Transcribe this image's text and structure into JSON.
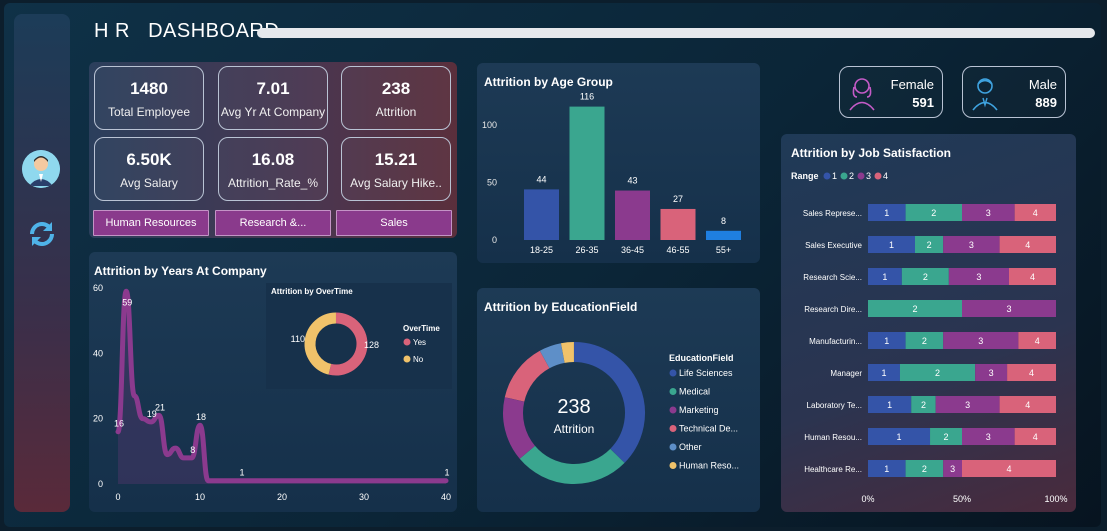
{
  "header": {
    "title": "H R   DASHBOARD"
  },
  "kpis": [
    {
      "value": "1480",
      "label": "Total Employee"
    },
    {
      "value": "7.01",
      "label": "Avg Yr At Company"
    },
    {
      "value": "238",
      "label": "Attrition"
    },
    {
      "value": "6.50K",
      "label": "Avg Salary"
    },
    {
      "value": "16.08",
      "label": "Attrition_Rate_%"
    },
    {
      "value": "15.21",
      "label": "Avg Salary Hike.."
    }
  ],
  "departments": [
    "Human Resources",
    "Research &...",
    "Sales"
  ],
  "gender": {
    "female": {
      "label": "Female",
      "value": "591"
    },
    "male": {
      "label": "Male",
      "value": "889"
    }
  },
  "age_chart": {
    "title": "Attrition by Age Group",
    "yticks": [
      "100",
      "50",
      "0"
    ],
    "colors": [
      "#3454a8",
      "#3aa68f",
      "#8b3a8e",
      "#d9637a",
      "#1f7fe0"
    ]
  },
  "edu_chart": {
    "title": "Attrition by EducationField",
    "center_value": "238",
    "center_label": "Attrition",
    "legend_title": "EducationField",
    "colors": [
      "#3454a8",
      "#3aa68f",
      "#8b3a8e",
      "#d9637a",
      "#5e8fc8",
      "#f0c26a"
    ]
  },
  "years_chart": {
    "title": "Attrition by Years At Company",
    "yticks": [
      "60",
      "40",
      "20",
      "0"
    ],
    "xticks": [
      "0",
      "10",
      "20",
      "30",
      "40"
    ],
    "labels": [
      {
        "text": "16",
        "x": 0,
        "y": 16
      },
      {
        "text": "59",
        "x": 1,
        "y": 59
      },
      {
        "text": "19",
        "x": 4,
        "y": 19
      },
      {
        "text": "21",
        "x": 5,
        "y": 21
      },
      {
        "text": "8",
        "x": 9,
        "y": 8
      },
      {
        "text": "18",
        "x": 10,
        "y": 18
      },
      {
        "text": "1",
        "x": 15,
        "y": 1
      },
      {
        "text": "1",
        "x": 40,
        "y": 1
      }
    ]
  },
  "overtime_chart": {
    "title": "Attrition by OverTime",
    "legend_title": "OverTime",
    "colors": [
      "#d9637a",
      "#f0c26a"
    ]
  },
  "satisfaction_chart": {
    "title": "Attrition by Job Satisfaction",
    "legend_title": "Range",
    "legend_items": [
      "1",
      "2",
      "3",
      "4"
    ],
    "colors": [
      "#3454a8",
      "#3aa68f",
      "#8b3a8e",
      "#d9637a"
    ],
    "xticks": [
      "0%",
      "50%",
      "100%"
    ]
  },
  "chart_data": [
    {
      "type": "bar",
      "title": "Attrition by Age Group",
      "categories": [
        "18-25",
        "26-35",
        "36-45",
        "46-55",
        "55+"
      ],
      "values": [
        44,
        116,
        43,
        27,
        8
      ],
      "ylim": [
        0,
        120
      ]
    },
    {
      "type": "pie",
      "title": "Attrition by EducationField",
      "categories": [
        "Life Sciences",
        "Medical",
        "Marketing",
        "Technical De...",
        "Other",
        "Human Reso..."
      ],
      "values": [
        89,
        63,
        35,
        32,
        12,
        7
      ]
    },
    {
      "type": "line",
      "title": "Attrition by Years At Company",
      "x": [
        0,
        1,
        2,
        3,
        4,
        5,
        6,
        7,
        8,
        9,
        10,
        11,
        12,
        13,
        14,
        15,
        16,
        17,
        18,
        19,
        20,
        21,
        22,
        23,
        24,
        25,
        26,
        27,
        28,
        29,
        30,
        31,
        32,
        33,
        34,
        35,
        36,
        37,
        38,
        39,
        40
      ],
      "values": [
        16,
        59,
        27,
        20,
        19,
        21,
        9,
        11,
        8,
        8,
        18,
        1,
        1,
        1,
        1,
        1,
        1,
        1,
        1,
        1,
        1,
        1,
        1,
        1,
        1,
        1,
        1,
        1,
        1,
        1,
        1,
        1,
        1,
        1,
        1,
        1,
        1,
        1,
        1,
        1,
        1
      ],
      "ylim": [
        0,
        60
      ],
      "xlim": [
        0,
        40
      ]
    },
    {
      "type": "pie",
      "title": "Attrition by OverTime",
      "categories": [
        "Yes",
        "No"
      ],
      "values": [
        128,
        110
      ]
    },
    {
      "type": "bar",
      "title": "Attrition by Job Satisfaction",
      "categories": [
        "Sales Represe...",
        "Sales Executive",
        "Research Scie...",
        "Research Dire...",
        "Manufacturin...",
        "Manager",
        "Laboratory Te...",
        "Human Resou...",
        "Healthcare Re..."
      ],
      "series": [
        {
          "name": "1",
          "values": [
            20,
            25,
            18,
            0,
            20,
            17,
            23,
            33,
            20
          ]
        },
        {
          "name": "2",
          "values": [
            30,
            15,
            25,
            50,
            20,
            40,
            13,
            17,
            20
          ]
        },
        {
          "name": "3",
          "values": [
            28,
            30,
            32,
            50,
            40,
            17,
            34,
            28,
            10
          ]
        },
        {
          "name": "4",
          "values": [
            22,
            30,
            25,
            0,
            20,
            26,
            30,
            22,
            50
          ]
        }
      ],
      "xlim": [
        0,
        100
      ]
    }
  ]
}
